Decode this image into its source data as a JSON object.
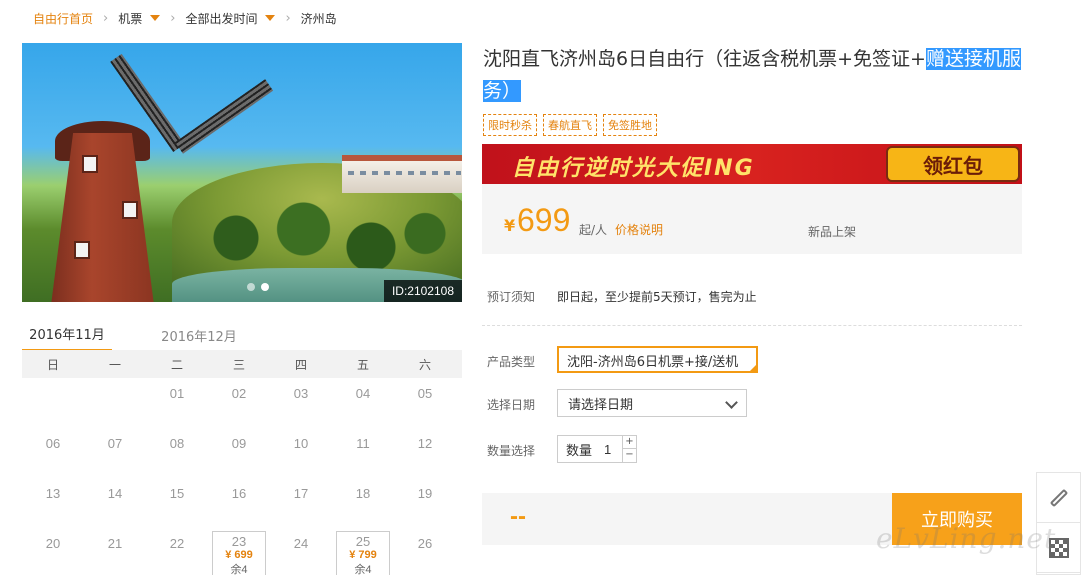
{
  "breadcrumb": {
    "home": "自由行首页",
    "items": [
      "机票",
      "全部出发时间",
      "济州岛"
    ]
  },
  "hero": {
    "id_tag": "ID:2102108"
  },
  "calendar": {
    "tabs": [
      "2016年11月",
      "2016年12月"
    ],
    "active_tab": 0,
    "weekdays": [
      "日",
      "一",
      "二",
      "三",
      "四",
      "五",
      "六"
    ],
    "rows": [
      [
        "",
        "",
        "01",
        "02",
        "03",
        "04",
        "05"
      ],
      [
        "06",
        "07",
        "08",
        "09",
        "10",
        "11",
        "12"
      ],
      [
        "13",
        "14",
        "15",
        "16",
        "17",
        "18",
        "19"
      ],
      [
        "20",
        "21",
        "22",
        "23",
        "24",
        "25",
        "26"
      ]
    ],
    "available": {
      "23": {
        "price": "¥ 699",
        "left": "余4"
      },
      "25": {
        "price": "¥ 799",
        "left": "余4"
      }
    }
  },
  "product": {
    "title_main": "沈阳直飞济州岛6日自由行（往返含税机票+免签证+",
    "title_highlight": "赠送接机服务）",
    "tags": [
      "限时秒杀",
      "春航直飞",
      "免签胜地"
    ],
    "promo_text": "自由行逆时光大促ING",
    "promo_button": "领红包",
    "price_symbol": "¥",
    "price": "699",
    "price_unit": "起/人",
    "price_note": "价格说明",
    "new_tag": "新品上架"
  },
  "booking": {
    "notice_label": "预订须知",
    "notice_value": "即日起，至少提前5天预订，售完为止",
    "type_label": "产品类型",
    "type_value": "沈阳-济州岛6日机票+接/送机",
    "date_label": "选择日期",
    "date_placeholder": "请选择日期",
    "qty_label": "数量选择",
    "qty_inner_label": "数量",
    "qty_value": "1",
    "plus": "+",
    "minus": "−",
    "total": "--",
    "buy_button": "立即购买"
  },
  "watermark": "eLvLing.net",
  "colors": {
    "accent": "#f39a13",
    "link": "#e4830f",
    "promo_red": "#c0111b"
  }
}
